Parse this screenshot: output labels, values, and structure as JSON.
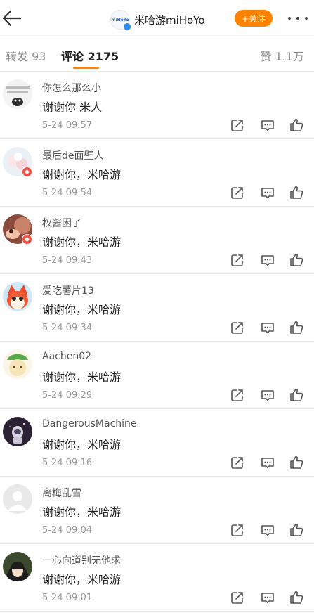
{
  "header": {
    "title": "米哈游miHoYo",
    "logo_text": "miHoYo",
    "follow_label": "+关注"
  },
  "tabs": {
    "repost": "转发 93",
    "comments": "评论 2175",
    "likes": "赞 1.1万"
  },
  "colors": {
    "accent": "#ff8200",
    "badge": "#f24d41",
    "verified": "#2c8cf0"
  },
  "comments": [
    {
      "user": "你怎么那么小",
      "text": "谢谢你 米人",
      "time": "5-24 09:57"
    },
    {
      "user": "最后de面壁人",
      "text": "谢谢你，米哈游",
      "time": "5-24 09:54"
    },
    {
      "user": "权酱困了",
      "text": "谢谢你，米哈游",
      "time": "5-24 09:43"
    },
    {
      "user": "爱吃薯片13",
      "text": "谢谢你，米哈游",
      "time": "5-24 09:34"
    },
    {
      "user": "Aachen02",
      "text": "谢谢你，米哈游",
      "time": "5-24 09:29"
    },
    {
      "user": "DangerousMachine",
      "text": "谢谢你，米哈游",
      "time": "5-24 09:16"
    },
    {
      "user": "离梅乱雪",
      "text": "谢谢你，米哈游",
      "time": "5-24 09:04"
    },
    {
      "user": "一心向道别无他求",
      "text": "谢谢你，米哈游",
      "time": "5-24 09:01"
    }
  ]
}
